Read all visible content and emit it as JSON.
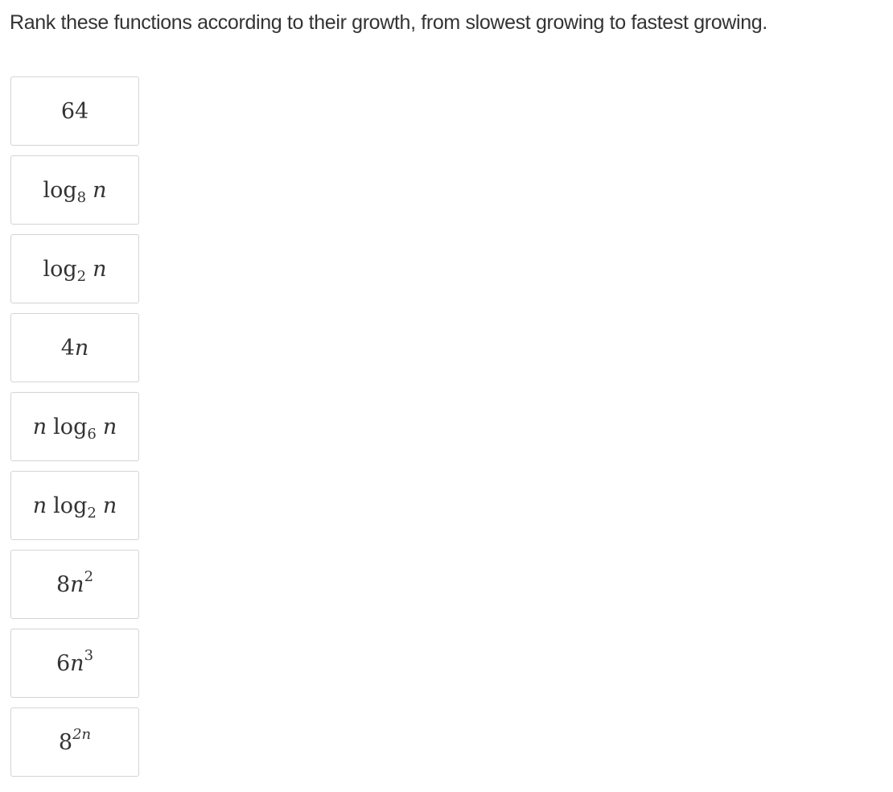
{
  "question": {
    "prompt": "Rank these functions according to their growth, from slowest growing to fastest growing."
  },
  "cards": [
    {
      "label": "64",
      "parts": {
        "coef": "64"
      }
    },
    {
      "label": "log₈ n",
      "parts": {
        "fn": "log",
        "base": "8",
        "var": "n"
      }
    },
    {
      "label": "log₂ n",
      "parts": {
        "fn": "log",
        "base": "2",
        "var": "n"
      }
    },
    {
      "label": "4n",
      "parts": {
        "coef": "4",
        "var": "n"
      }
    },
    {
      "label": "n log₆ n",
      "parts": {
        "pre": "n",
        "fn": "log",
        "base": "6",
        "var": "n"
      }
    },
    {
      "label": "n log₂ n",
      "parts": {
        "pre": "n",
        "fn": "log",
        "base": "2",
        "var": "n"
      }
    },
    {
      "label": "8n²",
      "parts": {
        "coef": "8",
        "var": "n",
        "exp": "2"
      }
    },
    {
      "label": "6n³",
      "parts": {
        "coef": "6",
        "var": "n",
        "exp": "3"
      }
    },
    {
      "label": "8²ⁿ",
      "parts": {
        "coef": "8",
        "exp": "2n"
      }
    }
  ]
}
